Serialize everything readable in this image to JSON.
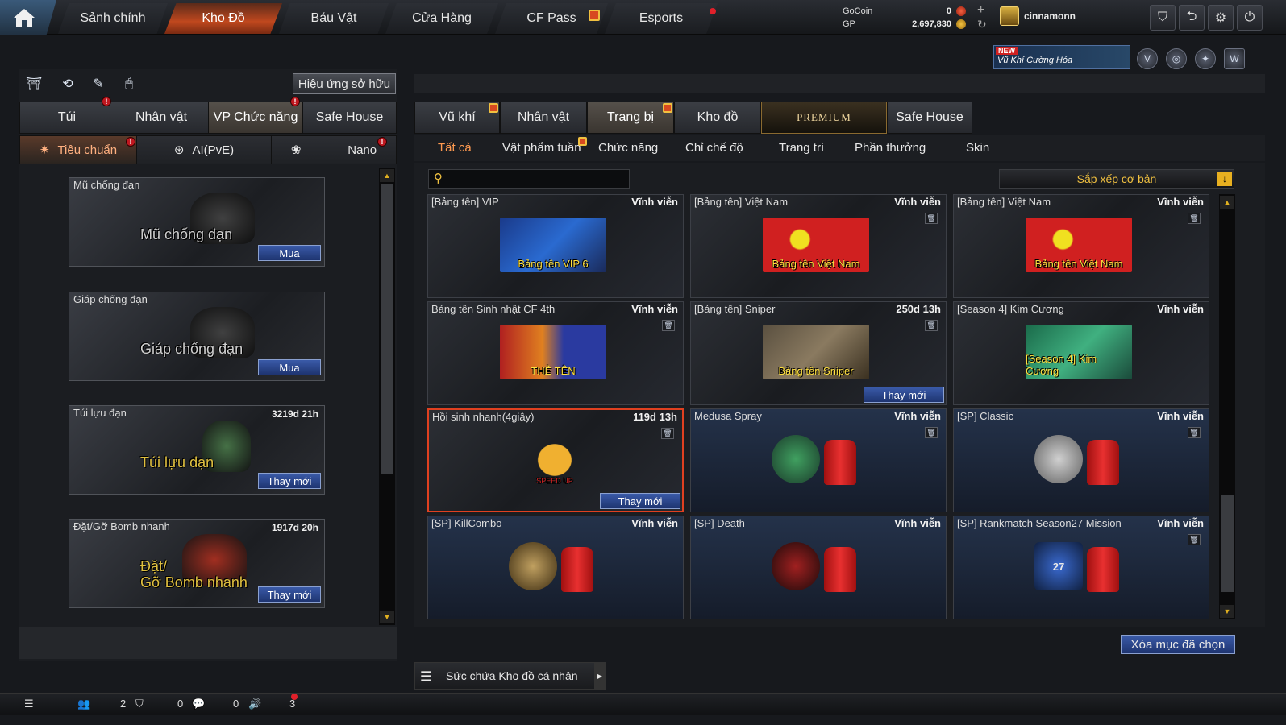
{
  "nav": {
    "items": [
      "Sảnh chính",
      "Kho Đồ",
      "Báu Vật",
      "Cửa Hàng",
      "CF Pass",
      "Esports"
    ],
    "active_index": 1
  },
  "currency": {
    "gocoin_label": "GoCoin",
    "gocoin_value": "0",
    "gp_label": "GP",
    "gp_value": "2,697,830"
  },
  "user": {
    "name": "cinnamonn"
  },
  "promo": {
    "new_tag": "NEW",
    "text": "Vũ Khí Cường Hóa"
  },
  "left": {
    "effect_button": "Hiệu ứng sở hữu",
    "tabs": [
      "Túi",
      "Nhân vật",
      "VP Chức năng",
      "Safe House"
    ],
    "active_tab": 2,
    "subtabs": [
      "Tiêu chuẩn",
      "AI(PvE)",
      "Nano"
    ],
    "active_subtab": 0,
    "cards": [
      {
        "name": "Mũ chống đạn",
        "time": "",
        "big": "Mũ chống đạn",
        "action": "Mua"
      },
      {
        "name": "Giáp chống đạn",
        "time": "",
        "big": "Giáp chống đạn",
        "action": "Mua"
      },
      {
        "name": "Túi lựu đạn",
        "time": "3219d 21h",
        "big": "Túi lựu đạn",
        "action": "Thay mới"
      },
      {
        "name": "Đặt/Gỡ Bomb nhanh",
        "time": "1917d 20h",
        "big": "Đặt/\nGỡ Bomb nhanh",
        "action": "Thay mới"
      }
    ]
  },
  "right": {
    "tabs": [
      "Vũ khí",
      "Nhân vật",
      "Trang bị",
      "Kho đồ",
      "PREMIUM",
      "Safe House"
    ],
    "active_tab": 2,
    "categories": [
      "Tất cả",
      "Vật phẩm tuần",
      "Chức năng",
      "Chỉ chế độ",
      "Trang trí",
      "Phần thưởng",
      "Skin"
    ],
    "active_category": 0,
    "search_placeholder": "",
    "sort_label": "Sắp xếp cơ bản",
    "items": [
      {
        "name": "[Bảng tên] VIP",
        "time": "Vĩnh viễn",
        "img_text": "Bảng tên VIP 6",
        "action": ""
      },
      {
        "name": "[Bảng tên] Việt Nam",
        "time": "Vĩnh viễn",
        "img_text": "Bảng tên Việt Nam",
        "action": ""
      },
      {
        "name": "[Bảng tên] Việt Nam",
        "time": "Vĩnh viễn",
        "img_text": "Bảng tên Việt Nam",
        "action": ""
      },
      {
        "name": "Bảng tên Sinh nhật CF 4th",
        "time": "Vĩnh viễn",
        "img_text": "THẺ TÊN",
        "action": ""
      },
      {
        "name": "[Bảng tên] Sniper",
        "time": "250d 13h",
        "img_text": "Bảng tên Sniper",
        "action": "Thay mới"
      },
      {
        "name": "[Season 4] Kim Cương",
        "time": "Vĩnh viễn",
        "img_text": "[Season 4] Kim Cương",
        "action": ""
      },
      {
        "name": "Hồi sinh nhanh(4giây)",
        "time": "119d 13h",
        "img_text": "SPEED UP",
        "action": "Thay mới"
      },
      {
        "name": "Medusa Spray",
        "time": "Vĩnh viễn",
        "img_text": "",
        "action": ""
      },
      {
        "name": "[SP] Classic",
        "time": "Vĩnh viễn",
        "img_text": "",
        "action": ""
      },
      {
        "name": "[SP] KillCombo",
        "time": "Vĩnh viễn",
        "img_text": "",
        "action": ""
      },
      {
        "name": "[SP] Death",
        "time": "Vĩnh viễn",
        "img_text": "",
        "action": ""
      },
      {
        "name": "[SP] Rankmatch Season27 Mission",
        "time": "Vĩnh viễn",
        "img_text": "27",
        "action": ""
      }
    ],
    "capacity_label": "Sức chứa Kho đồ cá nhân",
    "delete_button": "Xóa mục đã chọn"
  },
  "bottombar": {
    "friends_count": "2",
    "clan_count": "0",
    "chat_count": "0",
    "voice_count": "3"
  },
  "colors": {
    "accent": "#c0481e",
    "button_blue": "#2a4a98",
    "gold": "#f0c040"
  }
}
